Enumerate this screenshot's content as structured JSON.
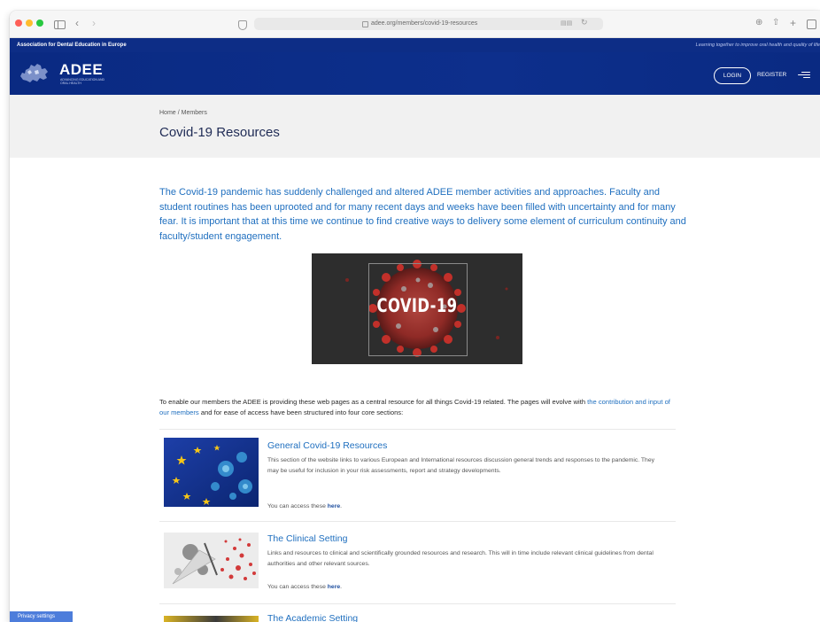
{
  "browser": {
    "url": "adee.org/members/covid-19-resources"
  },
  "site": {
    "org_name": "Association for Dental Education in Europe",
    "tagline": "Learning together to improve oral health and quality of life",
    "logo_text": "ADEE",
    "logo_subtext": "ADVANCING EDUCATION AND ORAL HEALTH",
    "nav": {
      "login": "LOGIN",
      "register": "REGISTER"
    }
  },
  "breadcrumb": {
    "home": "Home",
    "separator": "/",
    "current": "Members"
  },
  "page_title": "Covid-19 Resources",
  "intro": "The Covid-19 pandemic has suddenly challenged and altered ADEE member activities and approaches. Faculty and student routines has been uprooted and for many recent days and weeks have been filled with uncertainty and for many fear. It is important that at this time we continue to find creative ways to delivery some element of curriculum continuity and faculty/student engagement.",
  "hero_image_text": "COVID-19",
  "lead": {
    "before": "To enable our members the ADEE is providing these web pages as a central resource for all things Covid-19 related. The pages will evolve with ",
    "link": "the contribution and input of our members",
    "after": " and for ease of access have been structured into four core sections:"
  },
  "sections": [
    {
      "title": "General Covid-19 Resources",
      "description": "This section of the website links to various European and International resources discussion general trends and responses to the pandemic. They may be useful for inclusion in your risk assessments, report and strategy developments.",
      "access_text": "You can access these ",
      "access_link": "here",
      "access_end": "."
    },
    {
      "title": "The Clinical Setting",
      "description": "Links and resources to clinical and scientifically grounded resources and research. This will in time include relevant clinical guidelines from dental authorities and other relevant sources.",
      "access_text": "You can access these ",
      "access_link": "here",
      "access_end": "."
    },
    {
      "title": "The Academic Setting"
    }
  ],
  "privacy_button": "Privacy settings",
  "colors": {
    "brand_navy": "#0d2d86",
    "link_blue": "#1f6fbf"
  }
}
